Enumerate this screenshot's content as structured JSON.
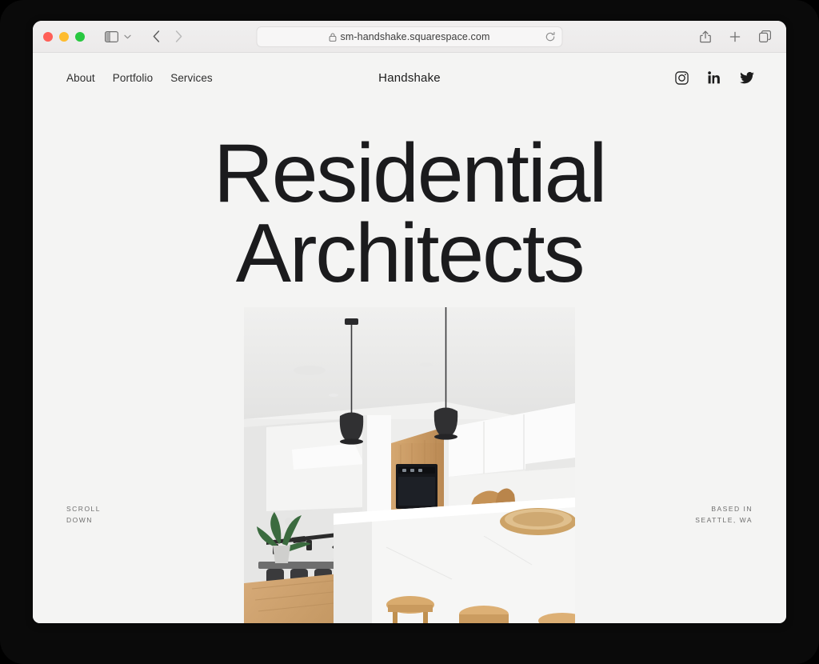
{
  "browser": {
    "traffic_lights": [
      "close",
      "minimize",
      "maximize"
    ],
    "sidebar_toggle_label": "Sidebar",
    "tab_overview_label": "Tab Overview",
    "back_label": "Back",
    "forward_label": "Forward",
    "url": "sm-handshake.squarespace.com",
    "reload_label": "Reload",
    "share_label": "Share",
    "new_tab_label": "New Tab",
    "colors": {
      "red": "#ff5f57",
      "yellow": "#febc2e",
      "green": "#28c840",
      "toolbar_bg": "#efeded",
      "url_bg": "#f7f6f6"
    }
  },
  "site": {
    "title": "Handshake",
    "nav": [
      {
        "label": "About"
      },
      {
        "label": "Portfolio"
      },
      {
        "label": "Services"
      }
    ],
    "social": [
      {
        "name": "instagram",
        "label": "Instagram"
      },
      {
        "name": "linkedin",
        "label": "LinkedIn"
      },
      {
        "name": "twitter",
        "label": "Twitter"
      }
    ],
    "hero": {
      "line1": "Residential",
      "line2": "Architects",
      "photo_alt": "Modern white kitchen interior with black pendant lamps, wood cabinetry and island with wooden stools"
    },
    "scroll_note": {
      "line1": "SCROLL",
      "line2": "DOWN"
    },
    "location_note": {
      "line1": "BASED IN",
      "line2": "SEATTLE, WA"
    },
    "colors": {
      "page_bg": "#f4f4f3",
      "text": "#1b1b1d",
      "muted": "#6e6e6e"
    }
  }
}
